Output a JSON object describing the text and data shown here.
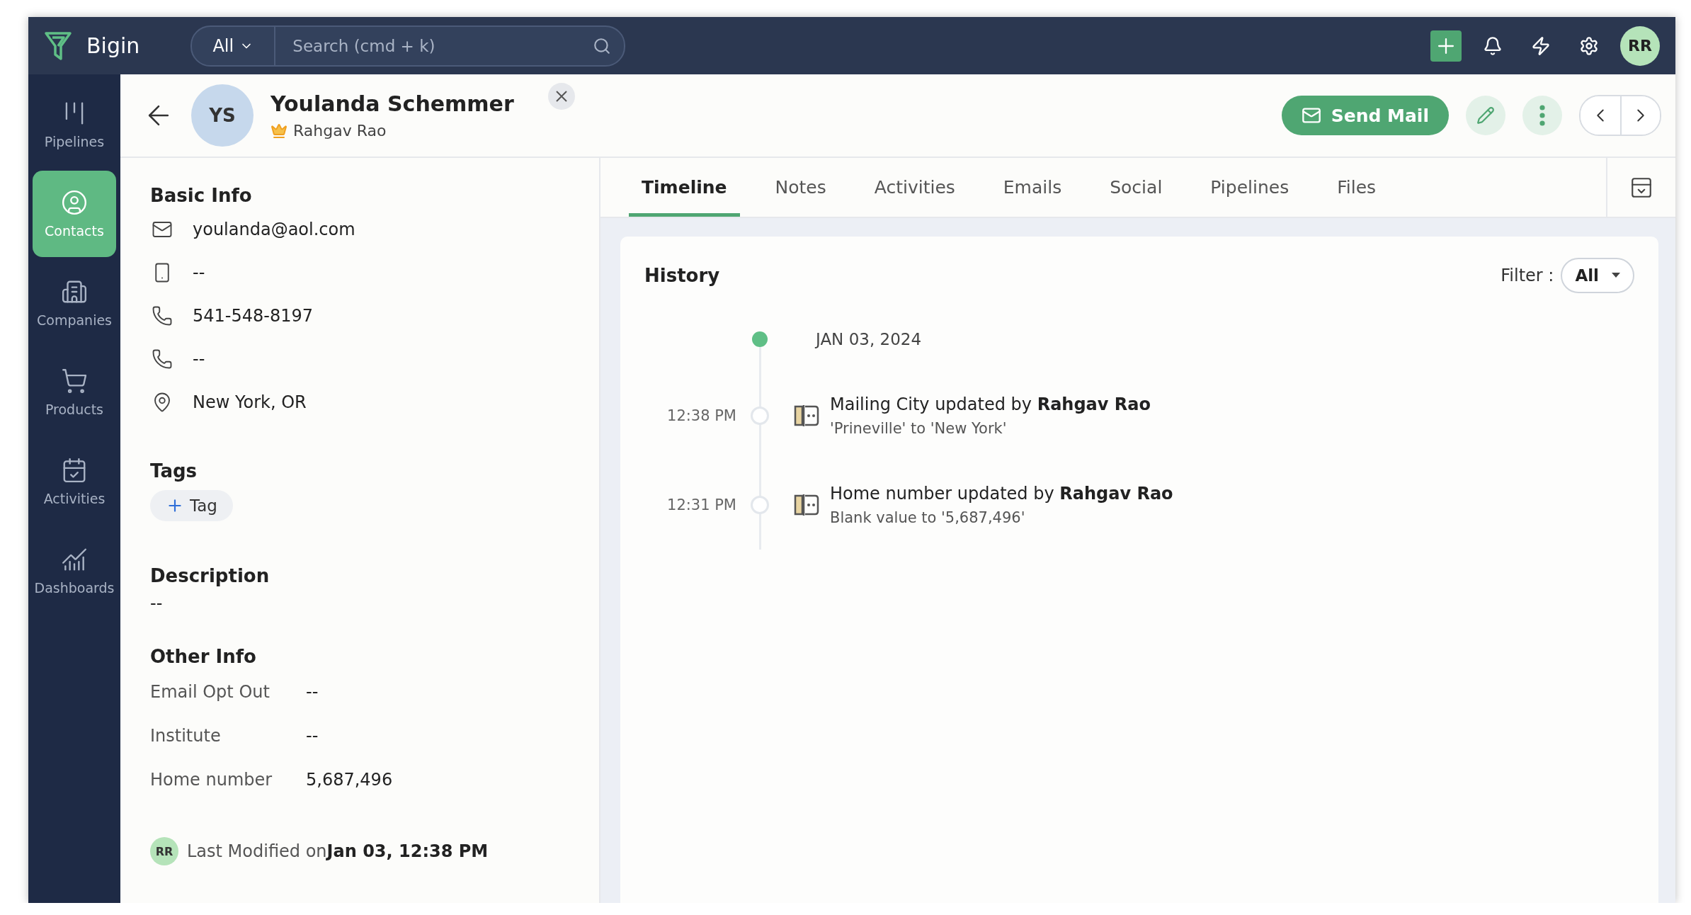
{
  "app": {
    "name": "Bigin"
  },
  "search": {
    "scope": "All",
    "placeholder": "Search (cmd + k)"
  },
  "user": {
    "initials": "RR"
  },
  "sidebar": {
    "items": [
      {
        "label": "Pipelines",
        "kind": "pipelines",
        "selected": false
      },
      {
        "label": "Contacts",
        "kind": "contacts",
        "selected": true
      },
      {
        "label": "Companies",
        "kind": "companies",
        "selected": false
      },
      {
        "label": "Products",
        "kind": "products",
        "selected": false
      },
      {
        "label": "Activities",
        "kind": "activities",
        "selected": false
      },
      {
        "label": "Dashboards",
        "kind": "dashboards",
        "selected": false
      }
    ]
  },
  "contact": {
    "initials": "YS",
    "name": "Youlanda Schemmer",
    "owner": "Rahgav Rao"
  },
  "actions": {
    "send_mail": "Send Mail"
  },
  "basic_info": {
    "title": "Basic Info",
    "fields": [
      {
        "kind": "email",
        "value": "youlanda@aol.com"
      },
      {
        "kind": "mobile",
        "value": "--"
      },
      {
        "kind": "phone",
        "value": "541-548-8197"
      },
      {
        "kind": "home_phone",
        "value": "--"
      },
      {
        "kind": "location",
        "value": "New York, OR"
      }
    ]
  },
  "tags": {
    "title": "Tags",
    "add": "Tag"
  },
  "description": {
    "title": "Description",
    "value": "--"
  },
  "other_info": {
    "title": "Other Info",
    "fields": [
      {
        "label": "Email Opt Out",
        "value": "--"
      },
      {
        "label": "Institute",
        "value": "--"
      },
      {
        "label": "Home number",
        "value": "5,687,496"
      }
    ]
  },
  "last_modified": {
    "initials": "RR",
    "text": "Last Modified on**Jan 03, 12:38 PM**"
  },
  "tabs": [
    {
      "label": "Timeline",
      "selected": true
    },
    {
      "label": "Notes",
      "selected": false
    },
    {
      "label": "Activities",
      "selected": false
    },
    {
      "label": "Emails",
      "selected": false
    },
    {
      "label": "Social",
      "selected": false
    },
    {
      "label": "Pipelines",
      "selected": false
    },
    {
      "label": "Files",
      "selected": false
    }
  ],
  "history": {
    "title": "History",
    "filter_label": "Filter :",
    "filter_value": "All",
    "date": "JAN 03, 2024",
    "entries": [
      {
        "time": "12:38 PM",
        "text": "Mailing City updated by **Rahgav Rao**",
        "detail": "'Prineville' to 'New York'"
      },
      {
        "time": "12:31 PM",
        "text": "Home number updated by **Rahgav Rao**",
        "detail": "Blank value to '5,687,496'"
      }
    ]
  }
}
